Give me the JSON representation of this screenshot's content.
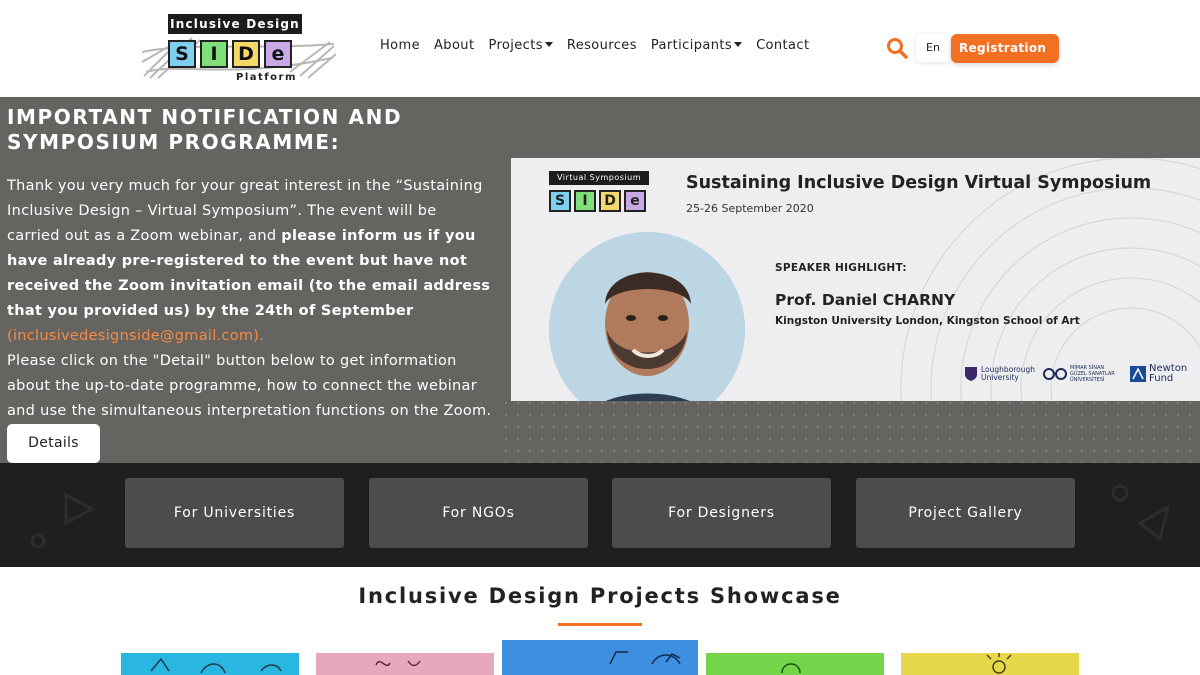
{
  "logo": {
    "top_text": "Inclusive Design",
    "letters": [
      {
        "char": "S",
        "color": "#7fd0f0"
      },
      {
        "char": "I",
        "color": "#7fe07a"
      },
      {
        "char": "D",
        "color": "#f5d86a"
      },
      {
        "char": "e",
        "color": "#c9a8e8"
      }
    ],
    "bottom_text": "Platform"
  },
  "nav": {
    "items": [
      {
        "label": "Home",
        "dropdown": false
      },
      {
        "label": "About",
        "dropdown": false
      },
      {
        "label": "Projects",
        "dropdown": true
      },
      {
        "label": "Resources",
        "dropdown": false
      },
      {
        "label": "Participants",
        "dropdown": true
      },
      {
        "label": "Contact",
        "dropdown": false
      }
    ],
    "search_icon": "search-icon",
    "language": "En",
    "registration_label": "Registration"
  },
  "hero": {
    "title": "IMPORTANT NOTIFICATION AND SYMPOSIUM PROGRAMME:",
    "text_intro": "Thank you very much for your great interest in the “Sustaining Inclusive Design – Virtual Symposium”. The event will be carried out as a Zoom webinar, and ",
    "text_bold": "please inform us if you have already pre-registered to the event but have not received the Zoom invitation email (to the email address that you provided us) by the 24th of September",
    "text_email": "(inclusivedesignside@gmail.com).",
    "text_outro": "Please click on the \"Detail\" button below to get information about the up-to-date programme, how to connect the webinar and use the simultaneous interpretation functions on the Zoom.",
    "details_label": "Details"
  },
  "banner": {
    "logo_top": "Virtual Symposium",
    "logo_year": "2020",
    "title": "Sustaining Inclusive Design Virtual Symposium",
    "date": "25-26 September 2020",
    "highlight_label": "SPEAKER HIGHLIGHT:",
    "speaker_name": "Prof. Daniel CHARNY",
    "speaker_affiliation": "Kingston University London, Kingston School of Art",
    "partners": [
      {
        "line1": "Loughborough",
        "line2": "University"
      },
      {
        "line1": "MİMAR SİNAN",
        "line2": "GÜZEL SANATLAR ÜNİVERSİTESİ"
      },
      {
        "line1": "Newton",
        "line2": "Fund"
      }
    ]
  },
  "categories": [
    {
      "label": "For Universities"
    },
    {
      "label": "For NGOs"
    },
    {
      "label": "For Designers"
    },
    {
      "label": "Project Gallery"
    }
  ],
  "showcase": {
    "title": "Inclusive Design Projects Showcase",
    "accent": "#f36f21",
    "thumb_colors": [
      "#29b6e0",
      "#e8a8bc",
      "#3f8fe0",
      "#74d44a",
      "#e6d84a"
    ]
  },
  "colors": {
    "accent": "#f36f21",
    "hero_bg": "#656461",
    "strip_bg": "#1f1f1f",
    "category_btn": "#4d4c4c"
  }
}
